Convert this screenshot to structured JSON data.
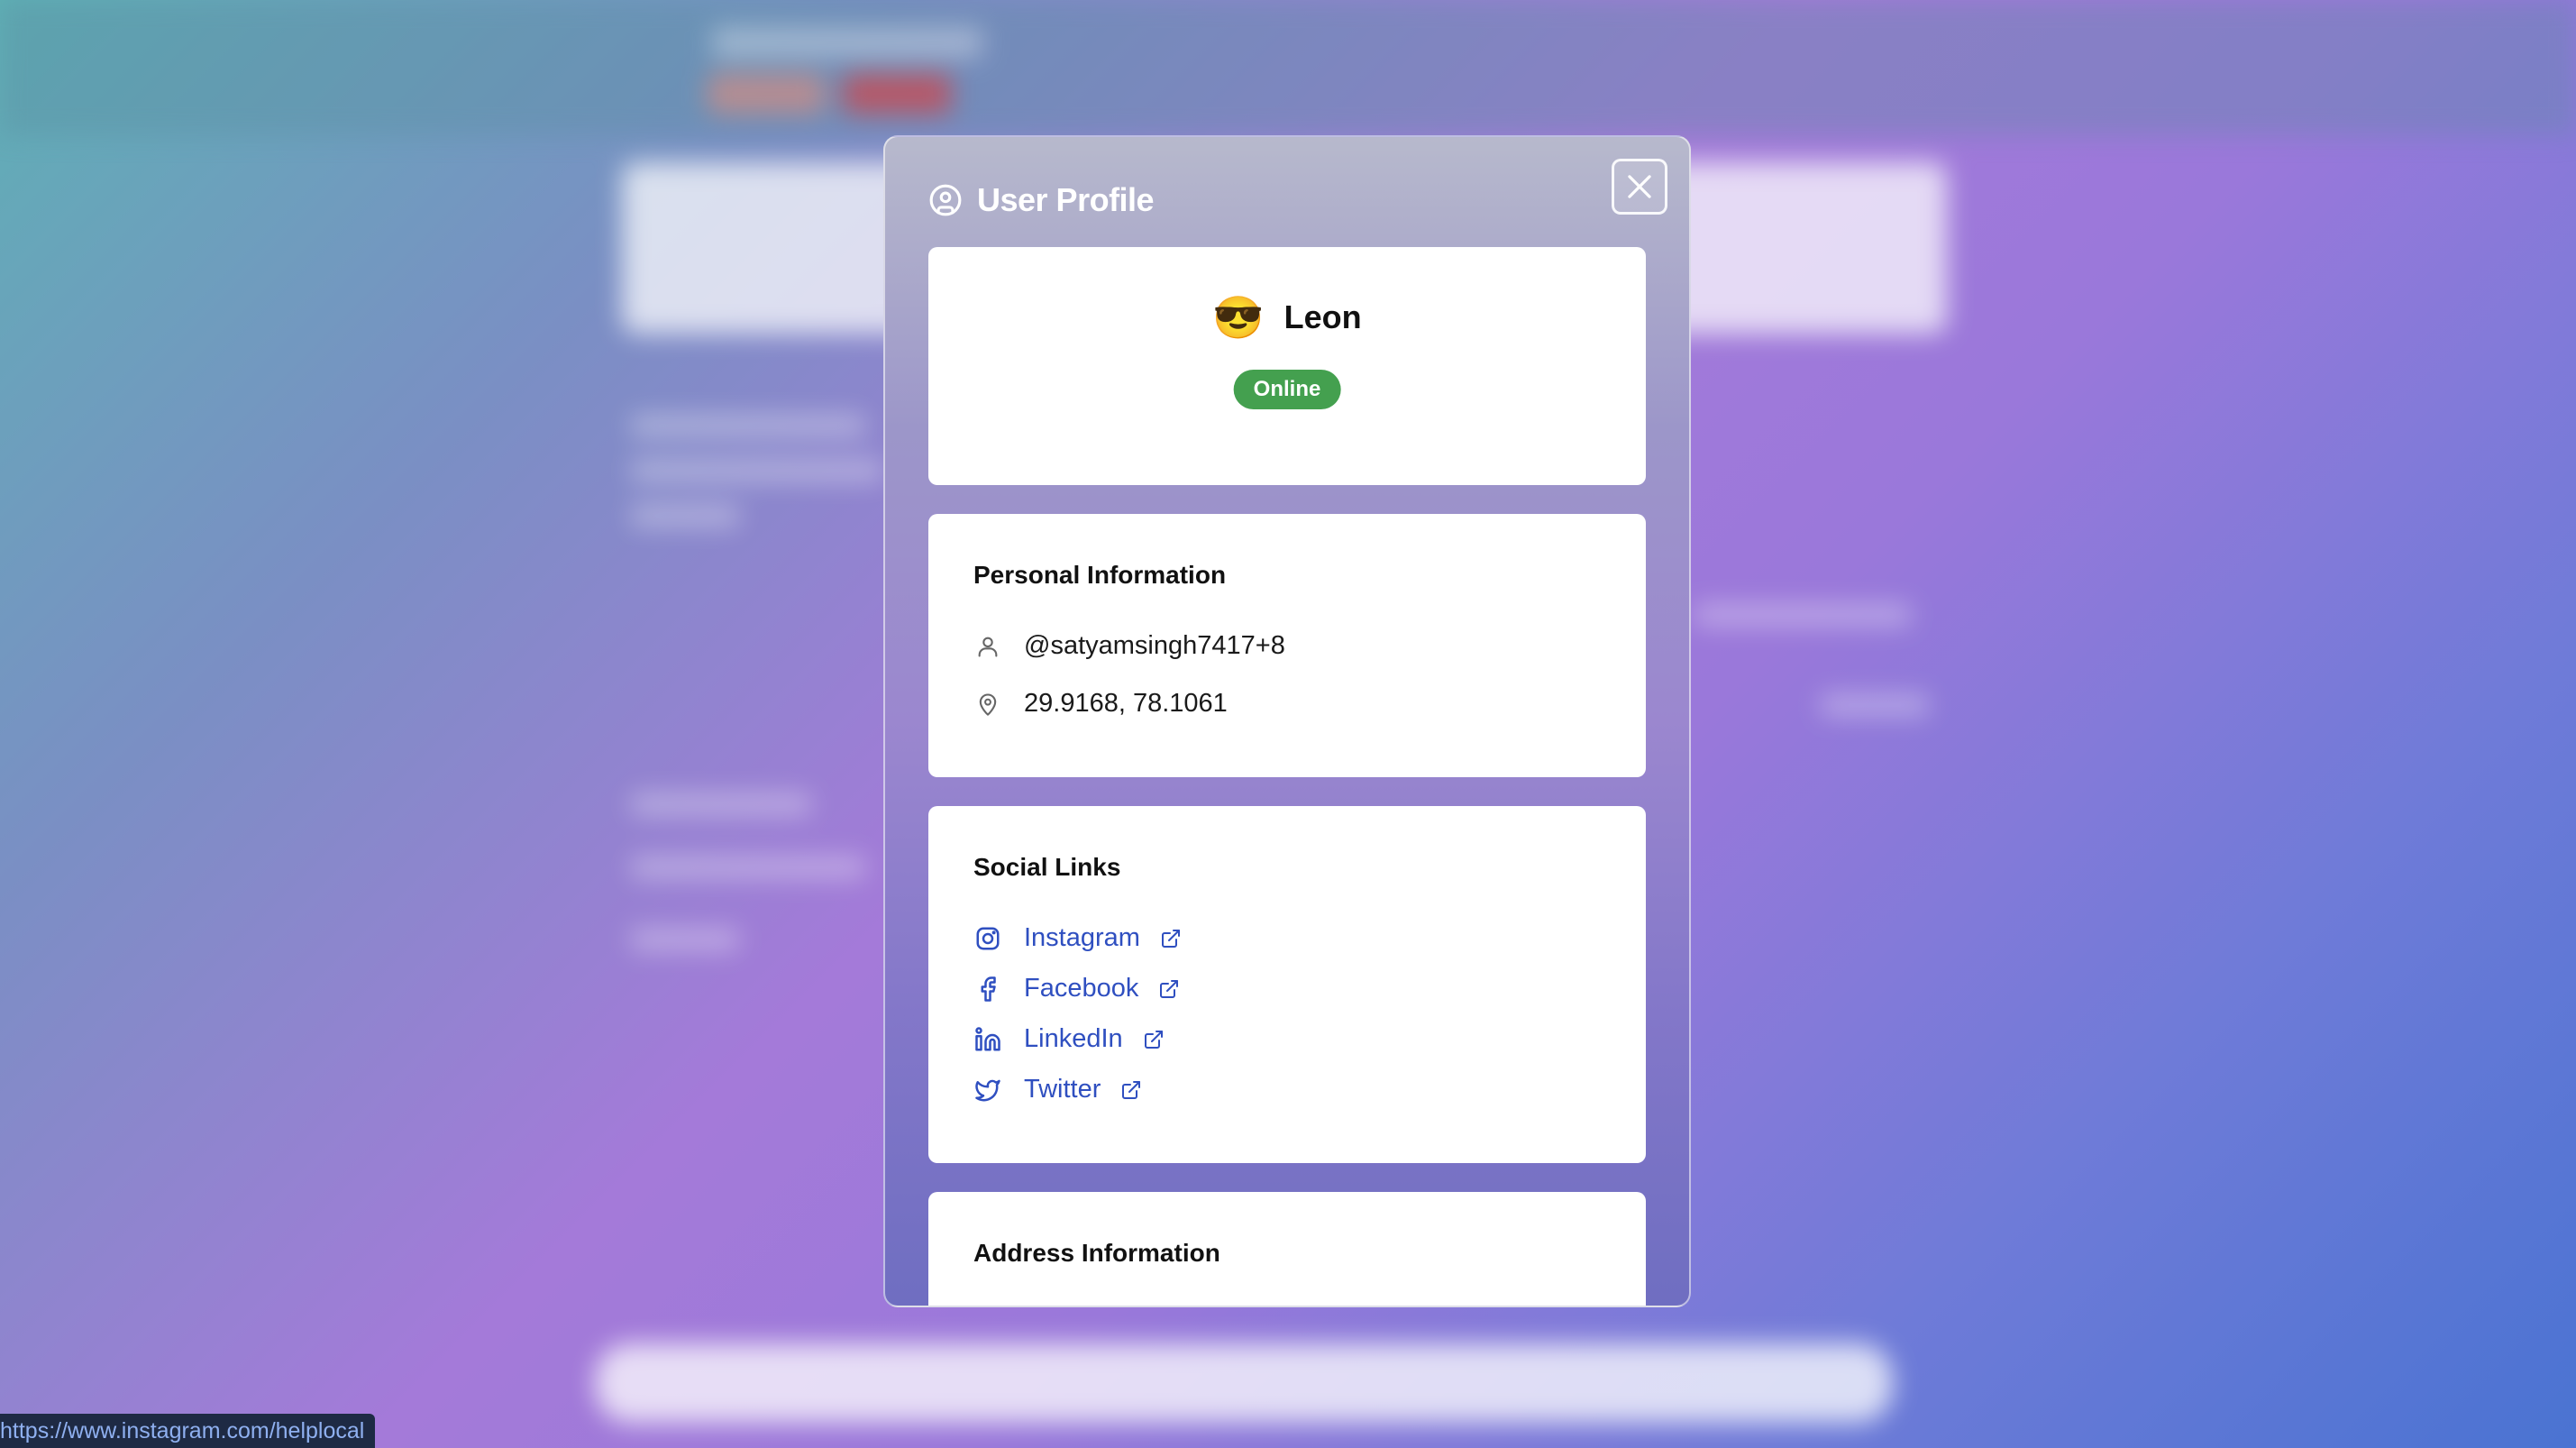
{
  "modal": {
    "title": "User Profile",
    "close_label": "Close"
  },
  "profile": {
    "emoji": "😎",
    "name": "Leon",
    "status": "Online"
  },
  "personal": {
    "title": "Personal Information",
    "username": "@satyamsingh7417+8",
    "location": "29.9168, 78.1061"
  },
  "social": {
    "title": "Social Links",
    "links": [
      {
        "label": "Instagram",
        "icon": "instagram-icon"
      },
      {
        "label": "Facebook",
        "icon": "facebook-icon"
      },
      {
        "label": "LinkedIn",
        "icon": "linkedin-icon"
      },
      {
        "label": "Twitter",
        "icon": "twitter-icon"
      }
    ]
  },
  "address": {
    "title": "Address Information"
  },
  "status_bar": {
    "url": "https://www.instagram.com/helplocal"
  },
  "colors": {
    "status_online": "#44a04f",
    "link": "#2f4fc0"
  }
}
